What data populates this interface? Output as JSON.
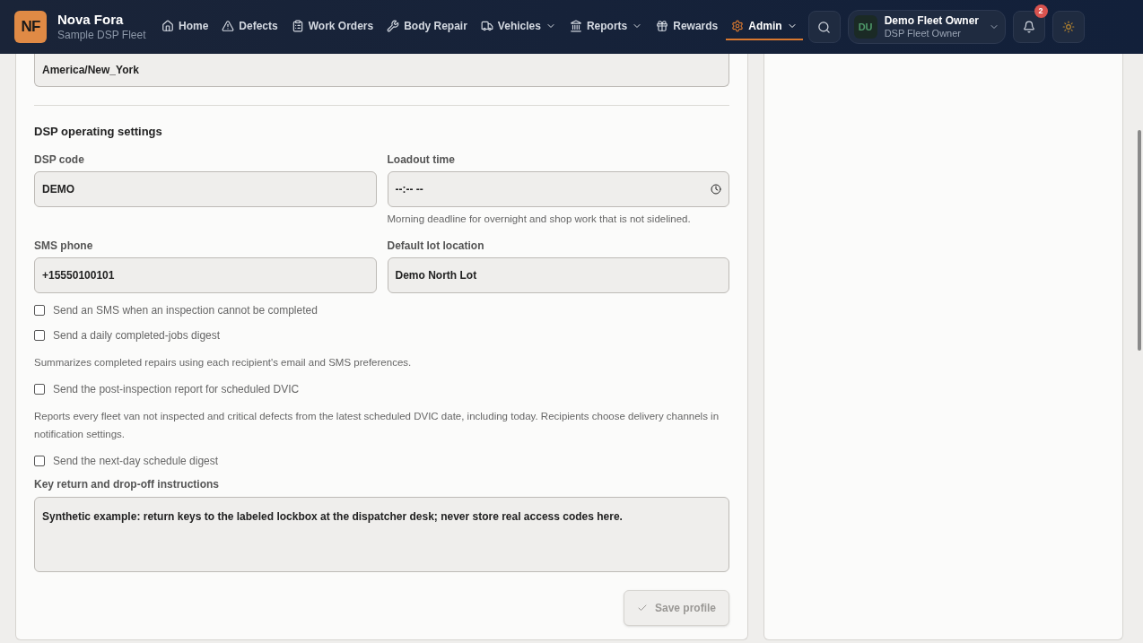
{
  "brand": {
    "logo": "NF",
    "name": "Nova Fora",
    "subtitle": "Sample DSP Fleet"
  },
  "nav": [
    {
      "label": "Home",
      "dropdown": false,
      "selected": false
    },
    {
      "label": "Defects",
      "dropdown": false,
      "selected": false
    },
    {
      "label": "Work Orders",
      "dropdown": false,
      "selected": false
    },
    {
      "label": "Body Repair",
      "dropdown": false,
      "selected": false
    },
    {
      "label": "Vehicles",
      "dropdown": true,
      "selected": false
    },
    {
      "label": "Reports",
      "dropdown": true,
      "selected": false
    },
    {
      "label": "Rewards",
      "dropdown": false,
      "selected": false
    },
    {
      "label": "Admin",
      "dropdown": true,
      "selected": true
    }
  ],
  "user": {
    "initials": "DU",
    "name": "Demo Fleet Owner",
    "role": "DSP Fleet Owner"
  },
  "notifications": {
    "count": "2"
  },
  "form": {
    "timezone_value": "America/New_York",
    "section_title": "DSP operating settings",
    "fields": [
      {
        "label": "DSP code",
        "value": "DEMO",
        "kind": "text"
      },
      {
        "label": "Loadout time",
        "value": "--:-- --",
        "kind": "time",
        "hint": "Morning deadline for overnight and shop work that is not sidelined."
      },
      {
        "label": "SMS phone",
        "value": "+15550100101",
        "kind": "text"
      },
      {
        "label": "Default lot location",
        "value": "Demo North Lot",
        "kind": "text"
      }
    ],
    "options": [
      {
        "kind": "checkbox",
        "label": "Send an SMS when an inspection cannot be completed",
        "checked": false
      },
      {
        "kind": "checkbox",
        "label": "Send a daily completed-jobs digest",
        "checked": false
      },
      {
        "kind": "note",
        "text": "Summarizes completed repairs using each recipient's email and SMS preferences."
      },
      {
        "kind": "checkbox",
        "label": "Send the post-inspection report for scheduled DVIC",
        "checked": false
      },
      {
        "kind": "note",
        "text": "Reports every fleet van not inspected and critical defects from the latest scheduled DVIC date, including today. Recipients choose delivery channels in notification settings."
      },
      {
        "kind": "checkbox",
        "label": "Send the next-day schedule digest",
        "checked": false
      }
    ],
    "instructions": {
      "label": "Key return and drop-off instructions",
      "value": "Synthetic example: return keys to the labeled lockbox at the dispatcher desk; never store real access codes here."
    },
    "save": {
      "label": "Save profile",
      "disabled": true
    }
  }
}
